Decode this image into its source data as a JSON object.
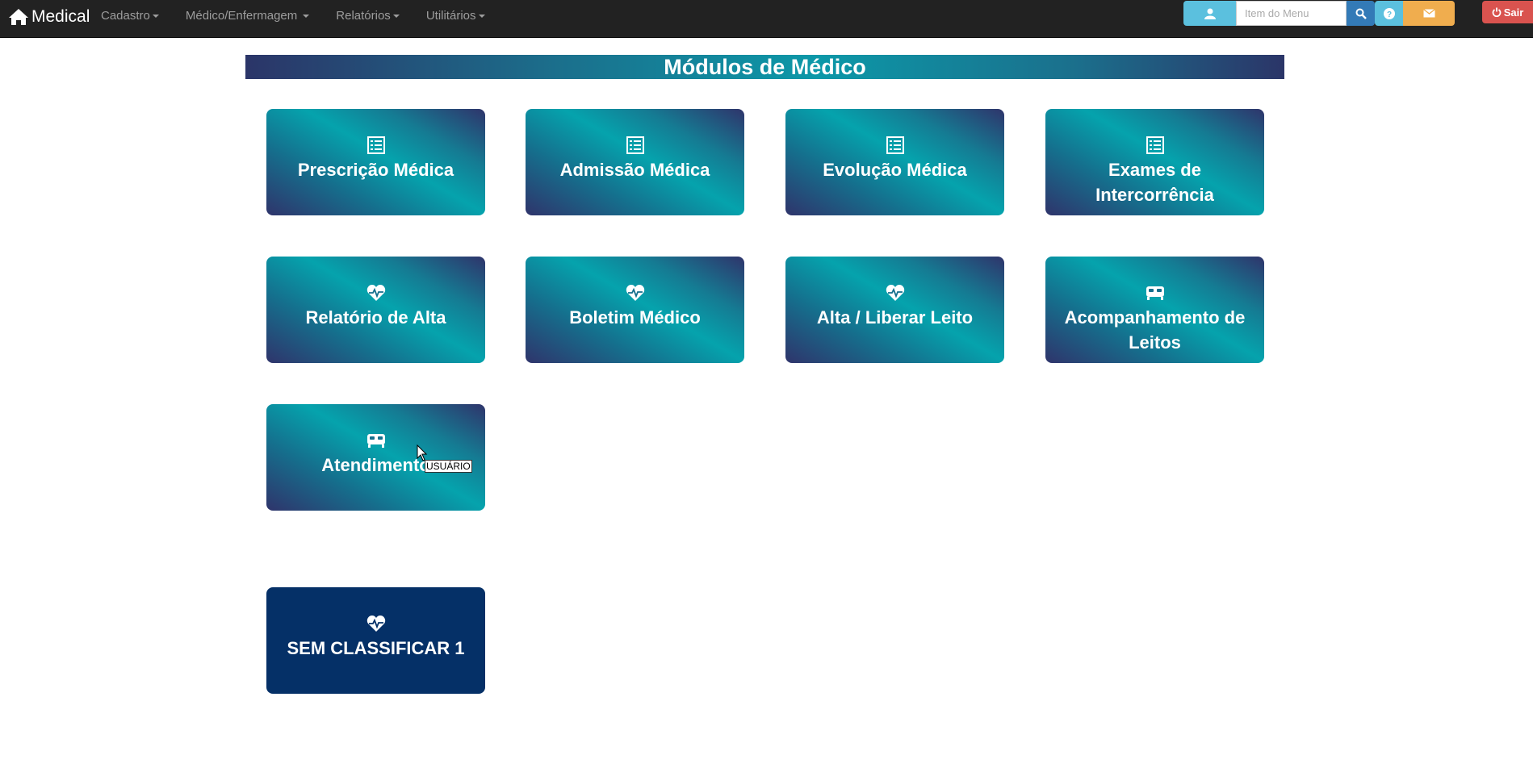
{
  "navbar": {
    "brand": "Medical",
    "menu": [
      {
        "label": "Cadastro"
      },
      {
        "label": "Médico/Enfermagem"
      },
      {
        "label": "Relatórios"
      },
      {
        "label": "Utilitários"
      }
    ],
    "search_placeholder": "Item do Menu",
    "logout_label": "Sair"
  },
  "banner": {
    "title": "Módulos de Médico"
  },
  "cards": [
    {
      "label": "Prescrição Médica",
      "icon": "list-icon"
    },
    {
      "label": "Admissão Médica",
      "icon": "list-icon"
    },
    {
      "label": "Evolução Médica",
      "icon": "list-icon"
    },
    {
      "label": "Exames de Intercorrência",
      "icon": "list-icon"
    },
    {
      "label": "Relatório de Alta",
      "icon": "heartbeat-icon"
    },
    {
      "label": "Boletim Médico",
      "icon": "heartbeat-icon"
    },
    {
      "label": "Alta / Liberar Leito",
      "icon": "heartbeat-icon"
    },
    {
      "label": "Acompanhamento de Leitos",
      "icon": "bed-icon"
    },
    {
      "label": "Atendimento",
      "icon": "bed-icon"
    },
    {
      "label": "SEM CLASSIFICAR 1",
      "icon": "heartbeat-icon"
    }
  ],
  "tooltip": "USUÁRIO",
  "colors": {
    "navbar": "#222222",
    "dark_card": "#053067",
    "teal": "#05a3ad",
    "indigo": "#2f346b"
  }
}
